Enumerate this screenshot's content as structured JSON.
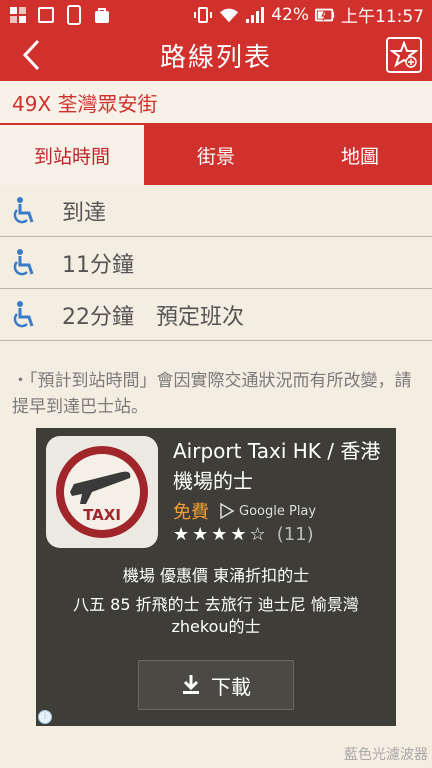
{
  "status": {
    "signal_pct": "42%",
    "time": "上午11:57"
  },
  "appbar": {
    "title": "路線列表"
  },
  "route": {
    "label": "49X 荃灣眾安街"
  },
  "tabs": [
    {
      "label": "到站時間"
    },
    {
      "label": "街景"
    },
    {
      "label": "地圖"
    }
  ],
  "arrivals": [
    {
      "text": "到達"
    },
    {
      "text": "11分鐘"
    },
    {
      "text": "22分鐘　預定班次"
    }
  ],
  "notice": {
    "text": "・「預計到站時間」會因實際交通狀況而有所改變，請提早到達巴士站。"
  },
  "ad": {
    "app_name": "Airport Taxi HK / 香港機場的士",
    "price": "免費",
    "store": "Google Play",
    "stars": "★★★★☆",
    "rating_count": "(11)",
    "icon_text": "TAXI",
    "line1": "機場 優惠價 東涌折扣的士",
    "line2": "八五 85 折飛的士 去旅行 迪士尼 愉景灣 zhekou的士",
    "download_label": "下載",
    "info": "i"
  },
  "watermark": "藍色光濾波器",
  "colors": {
    "brand_red": "#d0312d",
    "background": "#f4ede2",
    "accessible_blue": "#3a7bc8",
    "price_orange": "#f0a030",
    "ad_background": "#3e3d38"
  }
}
